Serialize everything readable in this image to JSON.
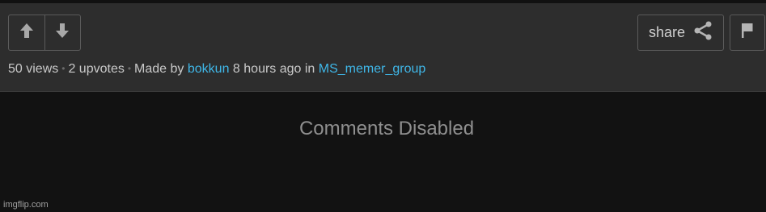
{
  "actions": {
    "share_label": "share"
  },
  "meta": {
    "views": "50 views",
    "upvotes": "2 upvotes",
    "made_by_prefix": "Made by",
    "author": "bokkun",
    "time_ago": "8 hours ago in",
    "group": "MS_memer_group",
    "separator": "•"
  },
  "comments": {
    "status": "Comments Disabled"
  },
  "watermark": {
    "text": "imgflip.com"
  },
  "colors": {
    "background": "#121212",
    "panel": "#2d2d2d",
    "link": "#3fb7e8",
    "text": "#c9c9c9",
    "muted": "#8f8f8f"
  }
}
